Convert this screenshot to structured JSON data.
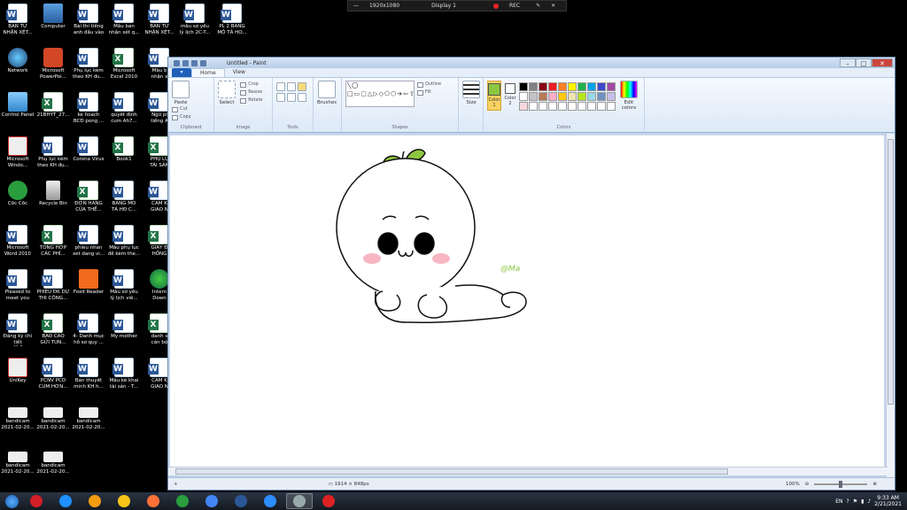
{
  "desktop": {
    "icons": [
      {
        "label": "BẢN TỰ\nNHẬN XÉT...",
        "type": "word"
      },
      {
        "label": "Computer",
        "type": "pc"
      },
      {
        "label": "Bài thi tiếng\nanh đầu vào",
        "type": "word"
      },
      {
        "label": "Mẫu bản\nnhận xét q...",
        "type": "word"
      },
      {
        "label": "BẢN TỰ\nNHẬN XÉT...",
        "type": "word"
      },
      {
        "label": "mẫu sơ yếu\nlý lịch 2C-T...",
        "type": "word"
      },
      {
        "label": "PL 2 BẢNG\nMÔ TẢ HO...",
        "type": "word"
      },
      {
        "label": "Network",
        "type": "net"
      },
      {
        "label": "Microsoft\nPowerPoi...",
        "type": "ppt"
      },
      {
        "label": "Phụ lục kèm\ntheo KH đu...",
        "type": "word"
      },
      {
        "label": "Microsoft\nExcel 2010",
        "type": "excel"
      },
      {
        "label": "Mẫu b\nnhận x",
        "type": "word"
      },
      {
        "label": "Control Panel",
        "type": "cpanel"
      },
      {
        "label": "21BHYT_27...",
        "type": "excel"
      },
      {
        "label": "ke hoach\nBCĐ pong ...",
        "type": "word"
      },
      {
        "label": "quyết định\ncum Ah7...",
        "type": "word"
      },
      {
        "label": "Ngữ pl\ntiếng A",
        "type": "word"
      },
      {
        "label": "Microsoft\nWindo...",
        "type": "acro"
      },
      {
        "label": "Phụ lục kèm\ntheo KH đu...",
        "type": "word"
      },
      {
        "label": "Corona Virus",
        "type": "word"
      },
      {
        "label": "Book1",
        "type": "excel"
      },
      {
        "label": "PHỤ LỤ\nTÀI SẢN",
        "type": "excel"
      },
      {
        "label": "Cốc Cốc",
        "type": "coccoc"
      },
      {
        "label": "Recycle Bin",
        "type": "bin"
      },
      {
        "label": "ĐƠN HÀNG\nCỦA THẾ...",
        "type": "excel"
      },
      {
        "label": "BẢNG MÔ\nTẢ HĐ C...",
        "type": "word"
      },
      {
        "label": "CAM K\nGIAO N",
        "type": "word"
      },
      {
        "label": "Microsoft\nWord 2010",
        "type": "word"
      },
      {
        "label": "TỔNG HỢP\nCÁC PHÍ...",
        "type": "excel"
      },
      {
        "label": "phieu nhan\nxet dang vi...",
        "type": "word"
      },
      {
        "label": "Mẫu phụ lục\nđề kèm the...",
        "type": "word"
      },
      {
        "label": "GIẤY Đ\nHỒNG",
        "type": "excel"
      },
      {
        "label": "Pleased to\nmeet you",
        "type": "word"
      },
      {
        "label": "PHIẾU ĐK DỰ\nTHI CÔNG...",
        "type": "word"
      },
      {
        "label": "Foxit Reader",
        "type": "foxit"
      },
      {
        "label": "Mẫu sơ yếu\nlý lịch viê...",
        "type": "word"
      },
      {
        "label": "Intern\nDown",
        "type": "inet"
      },
      {
        "label": "Đăng ký chi tiết\nđề 1",
        "type": "word"
      },
      {
        "label": "BÁO CÁO\nGỬI TUN...",
        "type": "excel"
      },
      {
        "label": "4- Danh mục\nhồ sơ quy ...",
        "type": "word"
      },
      {
        "label": "My mother",
        "type": "word"
      },
      {
        "label": "danh s\ncán bộ",
        "type": "excel"
      },
      {
        "label": "UniKey",
        "type": "unikey"
      },
      {
        "label": "PCNV PCD\nCUM HƠN...",
        "type": "word"
      },
      {
        "label": "Bản thuyết\nminh KH h...",
        "type": "word"
      },
      {
        "label": "Mẫu kê khai\ntài sản - T...",
        "type": "word"
      },
      {
        "label": "CAM K\nGIAO N",
        "type": "word"
      },
      {
        "label": "bandicam\n2021-02-20...",
        "type": "bcam"
      },
      {
        "label": "bandicam\n2021-02-20...",
        "type": "bcam"
      },
      {
        "label": "bandicam\n2021-02-20...",
        "type": "bcam"
      },
      {
        "label": "bandicam\n2021-02-20...",
        "type": "bcam"
      },
      {
        "label": "bandicam\n2021-02-20...",
        "type": "bcam"
      }
    ]
  },
  "recorder": {
    "resolution": "1920x1080",
    "display": "Display 1",
    "rec_label": "REC",
    "rec_color": "#e22222"
  },
  "paint": {
    "title": "Untitled - Paint",
    "tabs": [
      "Home",
      "View"
    ],
    "active_tab": "Home",
    "clipboard": {
      "paste": "Paste",
      "cut": "Cut",
      "copy": "Copy",
      "group": "Clipboard"
    },
    "image": {
      "select": "Select",
      "crop": "Crop",
      "resize": "Resize",
      "rotate": "Rotate",
      "group": "Image"
    },
    "tools_group": "Tools",
    "brushes": "Brushes",
    "shapes": {
      "outline": "Outline",
      "fill": "Fill",
      "group": "Shapes",
      "glyphs": "╲〇□▭▢△▷◇⬠⬡➔⇦⇧⇩✦✧✩☆◯▽◁▷◎☐"
    },
    "size": "Size",
    "color1": {
      "label": "Color\n1",
      "value": "#8dc63f"
    },
    "color2": {
      "label": "Color\n2",
      "value": "#ffffff"
    },
    "colors_group": "Colors",
    "edit_colors": "Edit\ncolors",
    "palette": [
      "#000000",
      "#7f7f7f",
      "#880015",
      "#ed1c24",
      "#ff7f27",
      "#fff200",
      "#22b14c",
      "#00a2e8",
      "#3f48cc",
      "#a349a4",
      "#ffffff",
      "#c3c3c3",
      "#b97a57",
      "#ffaec9",
      "#ffc90e",
      "#efe4b0",
      "#b5e61d",
      "#99d9ea",
      "#7092be",
      "#c8bfe7",
      "#f8d8e0",
      "#ffffff",
      "#ffffff",
      "#ffffff",
      "#ffffff",
      "#ffffff",
      "#ffffff",
      "#ffffff",
      "#ffffff",
      "#ffffff"
    ],
    "drawing": {
      "signature": "@Ma",
      "leaf_color": "#8dc63f",
      "blush_color": "#f7b6c2"
    },
    "status": {
      "size": "1914 × 848px",
      "zoom": "100%"
    }
  },
  "taskbar": {
    "apps": [
      "opera",
      "ie",
      "media",
      "explorer",
      "firefox",
      "coccoc",
      "chrome",
      "word",
      "zoom",
      "paint",
      "bandicam"
    ],
    "tray": {
      "lang": "EN",
      "time": "9:33 AM",
      "date": "2/21/2021"
    }
  }
}
